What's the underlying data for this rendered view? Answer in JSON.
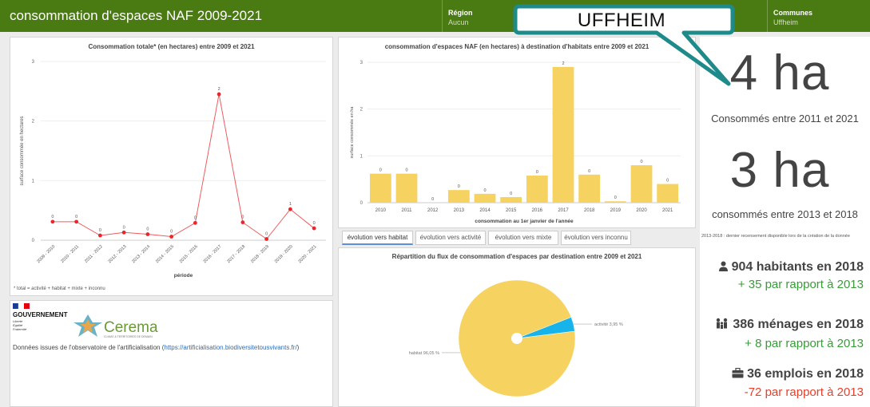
{
  "header": {
    "title": "consommation d'espaces NAF 2009-2021",
    "region_label": "Région",
    "region_value": "Aucun",
    "communes_label": "Communes",
    "communes_value": "Uffheim"
  },
  "callout": {
    "text": "UFFHEIM"
  },
  "chart_data": [
    {
      "type": "line",
      "title": "Consommation totale* (en hectares) entre 2009 et 2021",
      "xlabel": "période",
      "ylabel": "surface consommée en hectares",
      "footnote": "* total = activité + habitat + mixte + inconnu",
      "ylim": [
        0,
        3
      ],
      "yticks": [
        "0",
        "1",
        "2",
        "3"
      ],
      "categories": [
        "2009 - 2010",
        "2010 - 2011",
        "2011 - 2012",
        "2012 - 2013",
        "2013 - 2014",
        "2014 - 2015",
        "2015 - 2016",
        "2016 - 2017",
        "2017 - 2018",
        "2018 - 2019",
        "2019 - 2020",
        "2020 - 2021"
      ],
      "values": [
        0.31,
        0.31,
        0.08,
        0.13,
        0.1,
        0.06,
        0.29,
        2.45,
        0.3,
        0.02,
        0.52,
        0.2
      ],
      "labels": [
        "0",
        "0",
        "0",
        "0",
        "0",
        "0",
        "0",
        "2",
        "0",
        "0",
        "1",
        "0"
      ],
      "color": "#e8262b"
    },
    {
      "type": "bar",
      "title": "consommation d'espaces NAF (en hectares) à destination d'habitats entre 2009 et 2021",
      "xlabel": "consommation au 1er janvier de l'année",
      "ylabel": "surface consommée en ha",
      "ylim": [
        0,
        3
      ],
      "yticks": [
        "0",
        "1",
        "2",
        "3"
      ],
      "categories": [
        "2010",
        "2011",
        "2012",
        "2013",
        "2014",
        "2015",
        "2016",
        "2017",
        "2018",
        "2019",
        "2020",
        "2021"
      ],
      "values": [
        0.62,
        0.62,
        0.0,
        0.27,
        0.19,
        0.12,
        0.58,
        2.9,
        0.6,
        0.03,
        0.8,
        0.4
      ],
      "labels": [
        "0",
        "0",
        "0",
        "0",
        "0",
        "0",
        "0",
        "2",
        "0",
        "0",
        "0",
        "0"
      ],
      "color": "#f6d261"
    },
    {
      "type": "pie",
      "title": "Répartition du flux de consommation d'espaces par destination entre 2009 et 2021",
      "slices": [
        {
          "name": "habitat",
          "label": "habitat 96,05 %",
          "value": 96.05,
          "color": "#f6d261"
        },
        {
          "name": "activité",
          "label": "activité 3,95 %",
          "value": 3.95,
          "color": "#16b4ea"
        }
      ]
    }
  ],
  "tabs": [
    {
      "label": "évolution vers habitat",
      "active": true
    },
    {
      "label": "évolution vers activité",
      "active": false
    },
    {
      "label": "évolution vers mixte",
      "active": false
    },
    {
      "label": "évolution vers inconnu",
      "active": false
    }
  ],
  "logos": {
    "gouv": "GOUVERNEMENT",
    "gouv_motto": [
      "Liberté",
      "Égalité",
      "Fraternité"
    ],
    "cerema": "Cerema",
    "cerema_tagline": "CLIMAT & TERRITOIRES DE DEMAIN"
  },
  "source": {
    "text": "Données issues de l'observatoire de l'artificialisation (",
    "link": "https://artificialisation.biodiversitetousvivants.fr/",
    "end": ")"
  },
  "kpis": {
    "total_value": "4 ha",
    "total_caption": "Consommés entre 2011 et 2021",
    "recent_value": "3 ha",
    "recent_caption": "consommés entre 2013 et 2018",
    "note": "2013-2018 : dernier recensement disponible lors de la création de la donnée"
  },
  "stats": [
    {
      "icon": "person-icon",
      "text": "904 habitants en 2018",
      "delta": "+ 35 par rapport à 2013",
      "delta_color": "#3a9b3a"
    },
    {
      "icon": "family-icon",
      "text": "386 ménages en 2018",
      "delta": "+ 8 par rapport à 2013",
      "delta_color": "#3a9b3a"
    },
    {
      "icon": "briefcase-icon",
      "text": "36 emplois en 2018",
      "delta": "-72 par rapport à 2013",
      "delta_color": "#e8402b"
    }
  ],
  "colors": {
    "header": "#4a7a12",
    "callout_border": "#1e8a8a"
  }
}
